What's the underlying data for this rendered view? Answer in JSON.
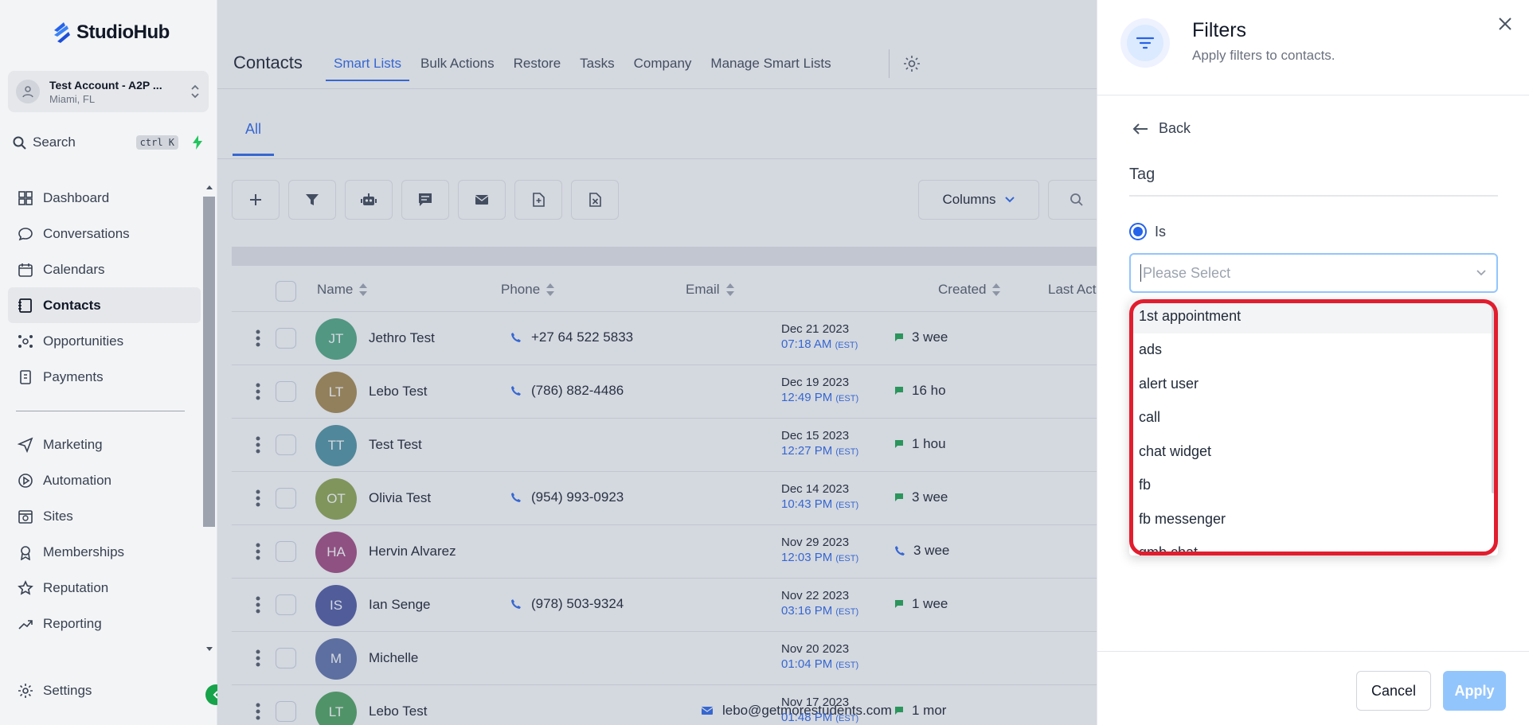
{
  "brand": {
    "name": "StudioHub",
    "accent": "#2563eb"
  },
  "account": {
    "name": "Test Account - A2P ...",
    "location": "Miami, FL"
  },
  "search": {
    "label": "Search",
    "shortcut": "ctrl K"
  },
  "sidebar": {
    "primary": [
      {
        "label": "Dashboard",
        "icon": "dashboard-icon"
      },
      {
        "label": "Conversations",
        "icon": "chat-icon"
      },
      {
        "label": "Calendars",
        "icon": "calendar-icon"
      },
      {
        "label": "Contacts",
        "icon": "contacts-icon",
        "active": true
      },
      {
        "label": "Opportunities",
        "icon": "opportunities-icon"
      },
      {
        "label": "Payments",
        "icon": "payments-icon"
      }
    ],
    "secondary": [
      {
        "label": "Marketing",
        "icon": "send-icon"
      },
      {
        "label": "Automation",
        "icon": "automation-icon"
      },
      {
        "label": "Sites",
        "icon": "sites-icon"
      },
      {
        "label": "Memberships",
        "icon": "memberships-icon"
      },
      {
        "label": "Reputation",
        "icon": "star-icon"
      },
      {
        "label": "Reporting",
        "icon": "trend-icon"
      }
    ],
    "settings_label": "Settings"
  },
  "header": {
    "title": "Contacts",
    "tabs": [
      "Smart Lists",
      "Bulk Actions",
      "Restore",
      "Tasks",
      "Company",
      "Manage Smart Lists"
    ],
    "active_tab": "Smart Lists"
  },
  "subtabs": {
    "all": "All"
  },
  "toolbar": {
    "columns_label": "Columns"
  },
  "table": {
    "headers": {
      "name": "Name",
      "phone": "Phone",
      "email": "Email",
      "created": "Created",
      "last_activity": "Last Activ"
    },
    "rows": [
      {
        "initials": "JT",
        "color": "#4aa57e",
        "name": "Jethro Test",
        "phone": "+27 64 522 5833",
        "email": "",
        "date": "Dec 21 2023",
        "time": "07:18 AM",
        "tz": "(EST)",
        "activity": "3 wee",
        "act_icon": "message-icon"
      },
      {
        "initials": "LT",
        "color": "#a4864a",
        "name": "Lebo Test",
        "phone": "(786) 882-4486",
        "email": "",
        "date": "Dec 19 2023",
        "time": "12:49 PM",
        "tz": "(EST)",
        "activity": "16 ho",
        "act_icon": "message-icon"
      },
      {
        "initials": "TT",
        "color": "#4a8fa0",
        "name": "Test Test",
        "phone": "",
        "email": "",
        "date": "Dec 15 2023",
        "time": "12:27 PM",
        "tz": "(EST)",
        "activity": "1 hou",
        "act_icon": "message-icon"
      },
      {
        "initials": "OT",
        "color": "#8aa34a",
        "name": "Olivia Test",
        "phone": "(954) 993-0923",
        "email": "",
        "date": "Dec 14 2023",
        "time": "10:43 PM",
        "tz": "(EST)",
        "activity": "3 wee",
        "act_icon": "message-icon"
      },
      {
        "initials": "HA",
        "color": "#a0457e",
        "name": "Hervin Alvarez",
        "phone": "",
        "email": "",
        "date": "Nov 29 2023",
        "time": "12:03 PM",
        "tz": "(EST)",
        "activity": "3 wee",
        "act_icon": "phone-icon"
      },
      {
        "initials": "IS",
        "color": "#4a55a0",
        "name": "Ian Senge",
        "phone": "(978) 503-9324",
        "email": "",
        "date": "Nov 22 2023",
        "time": "03:16 PM",
        "tz": "(EST)",
        "activity": "1 wee",
        "act_icon": "message-icon"
      },
      {
        "initials": "M",
        "color": "#5a6ea8",
        "name": "Michelle",
        "phone": "",
        "email": "",
        "date": "Nov 20 2023",
        "time": "01:04 PM",
        "tz": "(EST)",
        "activity": "",
        "act_icon": ""
      },
      {
        "initials": "LT",
        "color": "#4aa05a",
        "name": "Lebo Test",
        "phone": "",
        "email": "lebo@getmorestudents.com",
        "date": "Nov 17 2023",
        "time": "01:48 PM",
        "tz": "(EST)",
        "activity": "1 mor",
        "act_icon": "message-icon"
      }
    ]
  },
  "filters": {
    "title": "Filters",
    "subtitle": "Apply filters to contacts.",
    "back_label": "Back",
    "field_label": "Tag",
    "operator": "Is",
    "select_placeholder": "Please Select",
    "options": [
      "1st appointment",
      "ads",
      "alert user",
      "call",
      "chat widget",
      "fb",
      "fb messenger",
      "gmb chat"
    ],
    "cancel_label": "Cancel",
    "apply_label": "Apply",
    "highlight_color": "#e11d2e"
  }
}
